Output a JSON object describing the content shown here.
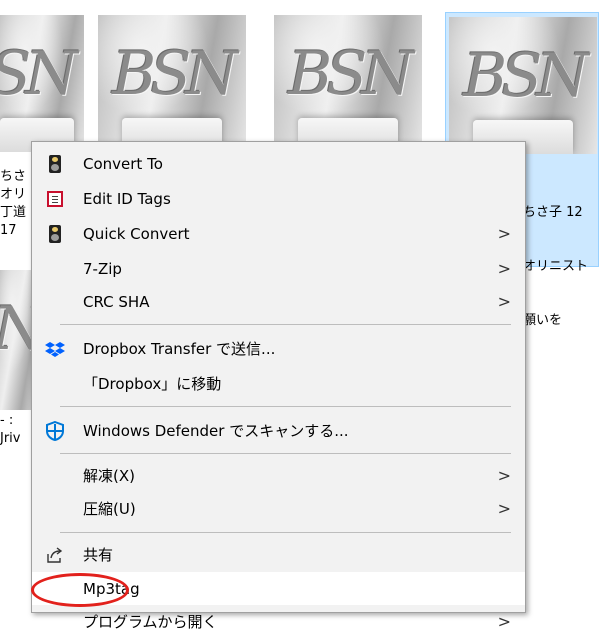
{
  "background": {
    "selected_text": [
      "ちさ子 12",
      "オリニスト",
      "願いを"
    ],
    "left_fragments": [
      "ちさ",
      "オリ",
      "丁道",
      "17",
      "- :",
      "Jriv"
    ]
  },
  "menu": {
    "items": [
      {
        "label": "Convert To",
        "icon": "speaker-icon",
        "submenu": false
      },
      {
        "label": "Edit ID Tags",
        "icon": "tag-list-icon",
        "submenu": false
      },
      {
        "label": "Quick Convert",
        "icon": "speaker-icon",
        "submenu": true
      },
      {
        "label": "7-Zip",
        "icon": "",
        "submenu": true
      },
      {
        "label": "CRC SHA",
        "icon": "",
        "submenu": true
      },
      {
        "label": "Dropbox Transfer で送信...",
        "icon": "dropbox-icon",
        "submenu": false
      },
      {
        "label": "「Dropbox」に移動",
        "icon": "",
        "submenu": false
      },
      {
        "label": "Windows Defender でスキャンする...",
        "icon": "windows-defender-icon",
        "submenu": false
      },
      {
        "label": "解凍(X)",
        "icon": "",
        "submenu": true
      },
      {
        "label": "圧縮(U)",
        "icon": "",
        "submenu": true
      },
      {
        "label": "共有",
        "icon": "share-icon",
        "submenu": false
      },
      {
        "label": "Mp3tag",
        "icon": "",
        "submenu": false
      },
      {
        "label": "プログラムから開く",
        "icon": "",
        "submenu": true
      }
    ],
    "arrow_glyph": ">"
  },
  "colors": {
    "menu_bg": "#f2f2f2",
    "selection": "#cce8ff",
    "highlight_ring": "#e2211c",
    "dropbox": "#0061fe",
    "defender": "#0078d7"
  }
}
